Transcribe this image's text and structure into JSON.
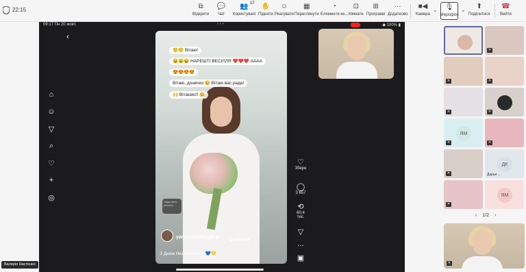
{
  "topbar": {
    "time": "22:15",
    "tools": [
      {
        "label": "Відкрити",
        "icon": "rooms-icon"
      },
      {
        "label": "Чат",
        "icon": "chat-icon"
      },
      {
        "label": "Користувачі",
        "icon": "people-icon",
        "count": "17"
      },
      {
        "label": "Підняти",
        "icon": "hand-icon"
      },
      {
        "label": "Реагувати",
        "icon": "smile-icon"
      },
      {
        "label": "Переглянути",
        "icon": "view-icon"
      },
      {
        "label": "Елементи ке...",
        "icon": "elements-icon"
      },
      {
        "label": "Кімнати",
        "icon": "breakout-icon"
      },
      {
        "label": "Програми",
        "icon": "apps-icon"
      },
      {
        "label": "Додатково",
        "icon": "more-icon"
      },
      {
        "label": "Камера",
        "icon": "camera-icon"
      },
      {
        "label": "Мікрофон",
        "icon": "mic-off-icon"
      },
      {
        "label": "Поділитися",
        "icon": "share-icon"
      },
      {
        "label": "Вийти",
        "icon": "leave-icon"
      }
    ]
  },
  "stage": {
    "status_time": "09:17  Пн 20 жовт.",
    "status_dots": "• • •",
    "status_right": "◆ 100% ▮",
    "comments": [
      "🙂🙂 Вітаю!",
      "😄😄😄 НАРЕШТІ ВЕСІЛЛЯ ❤️❤️❤️ АААА",
      "😍😍😍😍",
      "Вітаю, донечко 😊 Вітаю вас рада!",
      "🙌 Вітаємо!! 😊"
    ],
    "rail": [
      {
        "icon": "heart-icon",
        "text": "Збере"
      },
      {
        "icon": "comment-icon",
        "text": "3 657"
      },
      {
        "icon": "repost-icon",
        "text": "60,4 тис."
      },
      {
        "icon": "send-icon",
        "text": ""
      },
      {
        "icon": "more-dots-icon",
        "text": "..."
      },
      {
        "icon": "music-disc-icon",
        "text": ""
      }
    ],
    "user": "yanevychzhenya ◆",
    "follow": "Стежити",
    "caption": "З Днем Незалежності 💙💛 ...",
    "gift_label": "Надіслати вітання"
  },
  "sidebar": {
    "tiles": [
      {
        "type": "photo",
        "bg": "#efe9e6",
        "selected": true
      },
      {
        "type": "photo",
        "bg": "#d9c7c0"
      },
      {
        "type": "photo",
        "bg": "#e2ccbd"
      },
      {
        "type": "photo",
        "bg": "#e9d2c8"
      },
      {
        "type": "photo",
        "bg": "#e4e0e4"
      },
      {
        "type": "photo",
        "bg": "#d8d0cd"
      },
      {
        "type": "initials",
        "text": "ЯМ",
        "bg": "#d9eef0",
        "circle": "#cfe9e7"
      },
      {
        "type": "photo",
        "bg": "#e8b6bd"
      },
      {
        "type": "photo",
        "bg": "#d8cfc8"
      },
      {
        "type": "initials",
        "text": "ДК",
        "bg": "#e1e7ea",
        "circle": "#d7e1e6",
        "name": "Дарья ..."
      },
      {
        "type": "photo",
        "bg": "#e6c4c8"
      },
      {
        "type": "initials",
        "text": "ЯМ",
        "bg": "#f8e0de",
        "circle": "#f2c9c6"
      }
    ],
    "pager": "1/2",
    "self_name": "Валерія Настенко"
  }
}
